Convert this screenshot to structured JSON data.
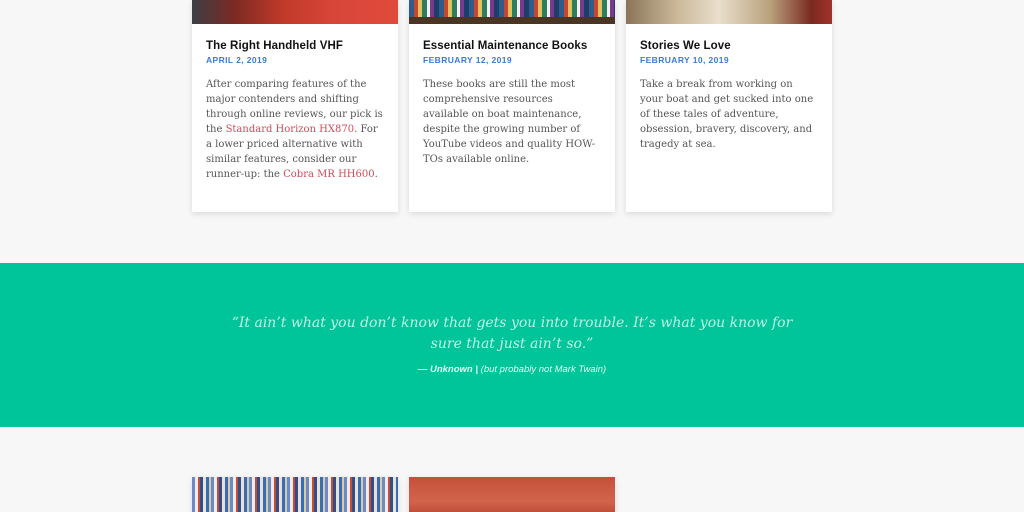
{
  "cards": [
    {
      "title": "The Right Handheld VHF",
      "date": "APRIL 2, 2019",
      "text_1": "After comparing features of the major contenders and shifting through online reviews, our pick is the ",
      "link_1": "Standard Horizon HX870",
      "text_2": ". For a lower priced alternative with similar features, consider our runner-up: the ",
      "link_2": "Cobra MR HH600",
      "text_3": "."
    },
    {
      "title": "Essential Maintenance Books",
      "date": "FEBRUARY 12, 2019",
      "text": "These books are still the most comprehensive resources available on boat maintenance, despite the growing number of YouTube videos and quality HOW-TOs available online."
    },
    {
      "title": "Stories We Love",
      "date": "FEBRUARY 10, 2019",
      "text": "Take a break from working on your boat and get sucked into one of these tales of adventure, obsession, bravery, discovery, and tragedy at sea."
    }
  ],
  "quote": {
    "line_1": "“It ain’t what you don’t know that gets you into trouble. It’s what you know for",
    "line_2": "sure that just ain’t so.”",
    "author": "— Unknown |",
    "author_note": "(but probably not Mark Twain)"
  },
  "colors": {
    "quote_band": "#00c49a",
    "date": "#3a7bd5",
    "link": "#d04a5a"
  }
}
